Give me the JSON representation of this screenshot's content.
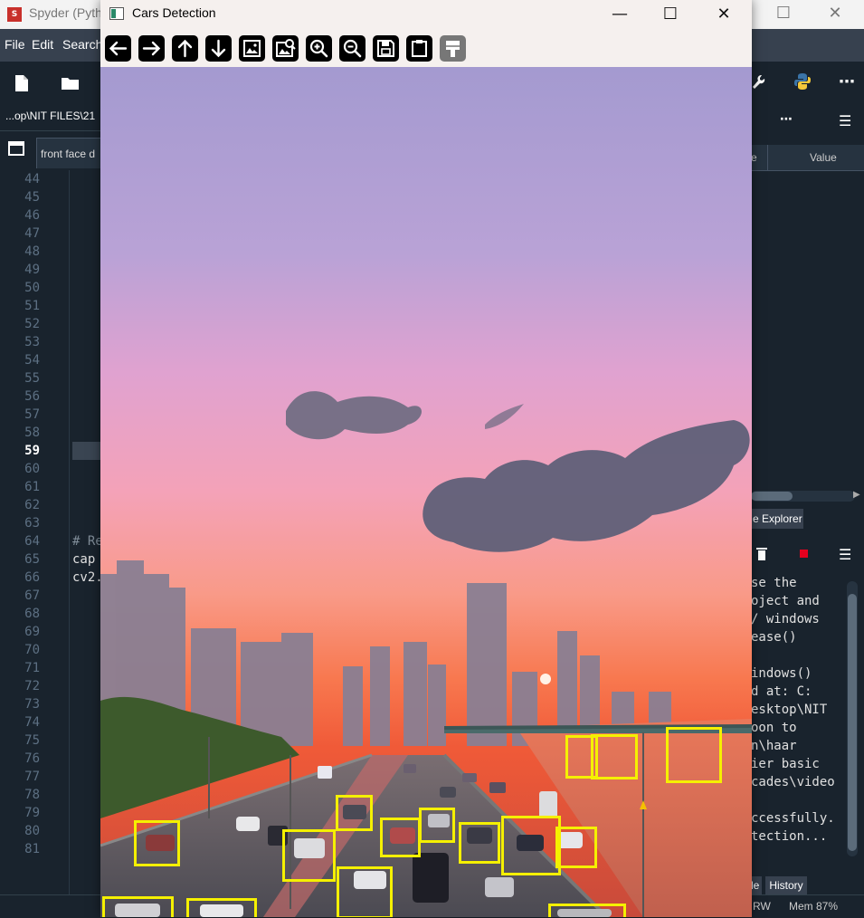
{
  "spyder": {
    "title": "Spyder (Pyth",
    "menu": [
      "File",
      "Edit",
      "Search"
    ],
    "path": "...op\\NIT FILES\\21",
    "editor_tab": "front face d",
    "line_numbers": [
      "44",
      "45",
      "46",
      "47",
      "48",
      "49",
      "50",
      "51",
      "52",
      "53",
      "54",
      "55",
      "56",
      "57",
      "58",
      "59",
      "60",
      "61",
      "62",
      "63",
      "64",
      "65",
      "66",
      "67",
      "68",
      "69",
      "70",
      "71",
      "72",
      "73",
      "74",
      "75",
      "76",
      "77",
      "78",
      "79",
      "80",
      "81"
    ],
    "current_line": "59",
    "code_lines": {
      "comment": "# Re",
      "line65": "cap",
      "line66": "cv2."
    },
    "variable_explorer": {
      "col_name": "e",
      "col_value": "Value",
      "tab_label": "e Explorer"
    },
    "console_lines": [
      "se the",
      "oject and",
      "/ windows",
      "ease()",
      "",
      "indows()",
      "d at: C:",
      "esktop\\NIT",
      "oon to",
      "n\\haar",
      "ier basic",
      "cades\\video",
      "",
      "ccessfully.",
      "tection..."
    ],
    "bottom_tabs": {
      "left_tab": "le",
      "history": "History"
    },
    "status": {
      "rw": "RW",
      "mem": "Mem 87%"
    }
  },
  "cv_window": {
    "title": "Cars Detection",
    "toolbar": [
      {
        "name": "pan-left-icon",
        "enabled": true
      },
      {
        "name": "pan-right-icon",
        "enabled": true
      },
      {
        "name": "pan-up-icon",
        "enabled": true
      },
      {
        "name": "pan-down-icon",
        "enabled": true
      },
      {
        "name": "zoom-fit-icon",
        "enabled": true
      },
      {
        "name": "zoom-original-icon",
        "enabled": true
      },
      {
        "name": "zoom-in-icon",
        "enabled": true
      },
      {
        "name": "zoom-out-icon",
        "enabled": true
      },
      {
        "name": "save-icon",
        "enabled": true
      },
      {
        "name": "copy-clipboard-icon",
        "enabled": true
      },
      {
        "name": "properties-brush-icon",
        "enabled": false
      }
    ],
    "detection_color": "#f5f000"
  }
}
